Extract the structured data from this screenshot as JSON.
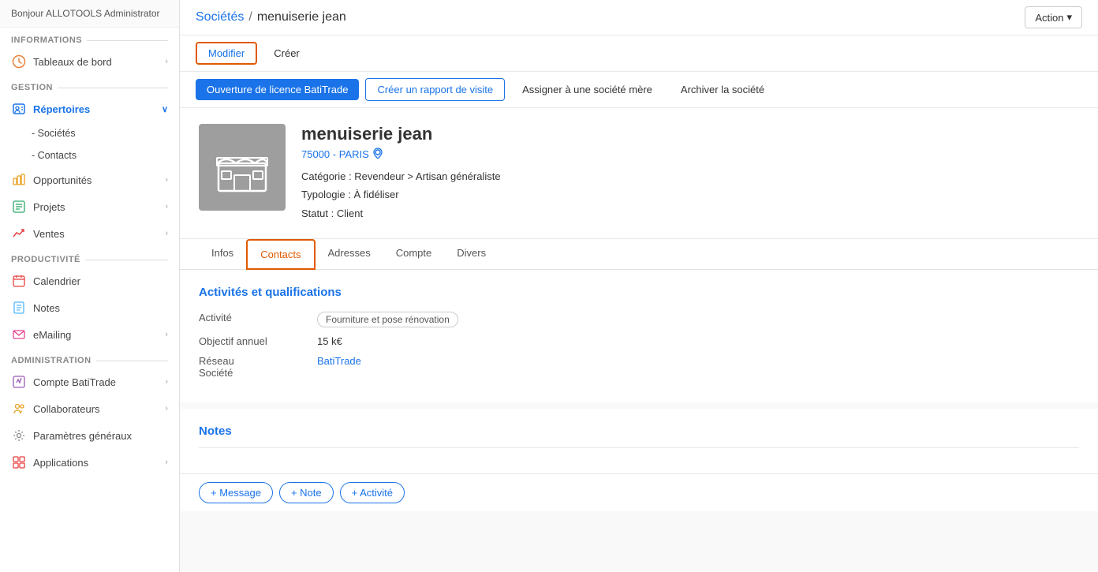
{
  "sidebar": {
    "greeting": "Bonjour ALLOTOOLS Administrator",
    "sections": [
      {
        "label": "INFORMATIONS",
        "items": [
          {
            "id": "tableaux-de-bord",
            "label": "Tableaux de bord",
            "hasChevron": true,
            "icon": "clock-icon"
          }
        ]
      },
      {
        "label": "GESTION",
        "items": [
          {
            "id": "repertoires",
            "label": "Répertoires",
            "hasChevron": true,
            "icon": "contacts-icon",
            "active": true,
            "expanded": true
          },
          {
            "id": "societes",
            "label": "- Sociétés",
            "isSub": true
          },
          {
            "id": "contacts",
            "label": "- Contacts",
            "isSub": true
          },
          {
            "id": "opportunites",
            "label": "Opportunités",
            "hasChevron": true,
            "icon": "opportunities-icon"
          },
          {
            "id": "projets",
            "label": "Projets",
            "hasChevron": true,
            "icon": "projets-icon"
          },
          {
            "id": "ventes",
            "label": "Ventes",
            "hasChevron": true,
            "icon": "ventes-icon"
          }
        ]
      },
      {
        "label": "PRODUCTIVITÉ",
        "items": [
          {
            "id": "calendrier",
            "label": "Calendrier",
            "hasChevron": false,
            "icon": "calendar-icon"
          },
          {
            "id": "notes",
            "label": "Notes",
            "hasChevron": false,
            "icon": "notes-icon"
          },
          {
            "id": "emailing",
            "label": "eMailing",
            "hasChevron": true,
            "icon": "emailing-icon"
          }
        ]
      },
      {
        "label": "ADMINISTRATION",
        "items": [
          {
            "id": "compte-batitrade",
            "label": "Compte BatiTrade",
            "hasChevron": true,
            "icon": "compte-icon"
          },
          {
            "id": "collaborateurs",
            "label": "Collaborateurs",
            "hasChevron": true,
            "icon": "collaborateurs-icon"
          },
          {
            "id": "parametres",
            "label": "Paramètres généraux",
            "hasChevron": false,
            "icon": "settings-icon"
          },
          {
            "id": "applications",
            "label": "Applications",
            "hasChevron": true,
            "icon": "applications-icon"
          }
        ]
      }
    ]
  },
  "topbar": {
    "breadcrumb_link": "Sociétés",
    "breadcrumb_separator": "/",
    "breadcrumb_current": "menuiserie jean",
    "action_label": "Action",
    "action_chevron": "▾"
  },
  "toolbar": {
    "modifier_label": "Modifier",
    "creer_label": "Créer"
  },
  "action_bar": {
    "btn1": "Ouverture de licence BatiTrade",
    "btn2": "Créer un rapport de visite",
    "btn3": "Assigner à une société mère",
    "btn4": "Archiver la société"
  },
  "record": {
    "company_name": "menuiserie jean",
    "location": "75000 - PARIS",
    "category_label": "Catégorie :",
    "category_value": "Revendeur > Artisan généraliste",
    "typology_label": "Typologie :",
    "typology_value": "À fidéliser",
    "status_label": "Statut :",
    "status_value": "Client"
  },
  "tabs": [
    {
      "id": "infos",
      "label": "Infos",
      "active": false
    },
    {
      "id": "contacts",
      "label": "Contacts",
      "active": true
    },
    {
      "id": "adresses",
      "label": "Adresses",
      "active": false
    },
    {
      "id": "compte",
      "label": "Compte",
      "active": false
    },
    {
      "id": "divers",
      "label": "Divers",
      "active": false
    }
  ],
  "activites_section": {
    "title": "Activités et qualifications",
    "fields": [
      {
        "label": "Activité",
        "value": "Fourniture et pose rénovation",
        "is_tag": true
      },
      {
        "label": "Objectif annuel",
        "value": "15 k€"
      },
      {
        "label": "Réseau\nSociété",
        "value": "BatiTrade",
        "is_link": true
      }
    ]
  },
  "notes_section": {
    "title": "Notes"
  },
  "bottom_bar": {
    "btn_message": "+ Message",
    "btn_note": "+ Note",
    "btn_activite": "+ Activité"
  }
}
